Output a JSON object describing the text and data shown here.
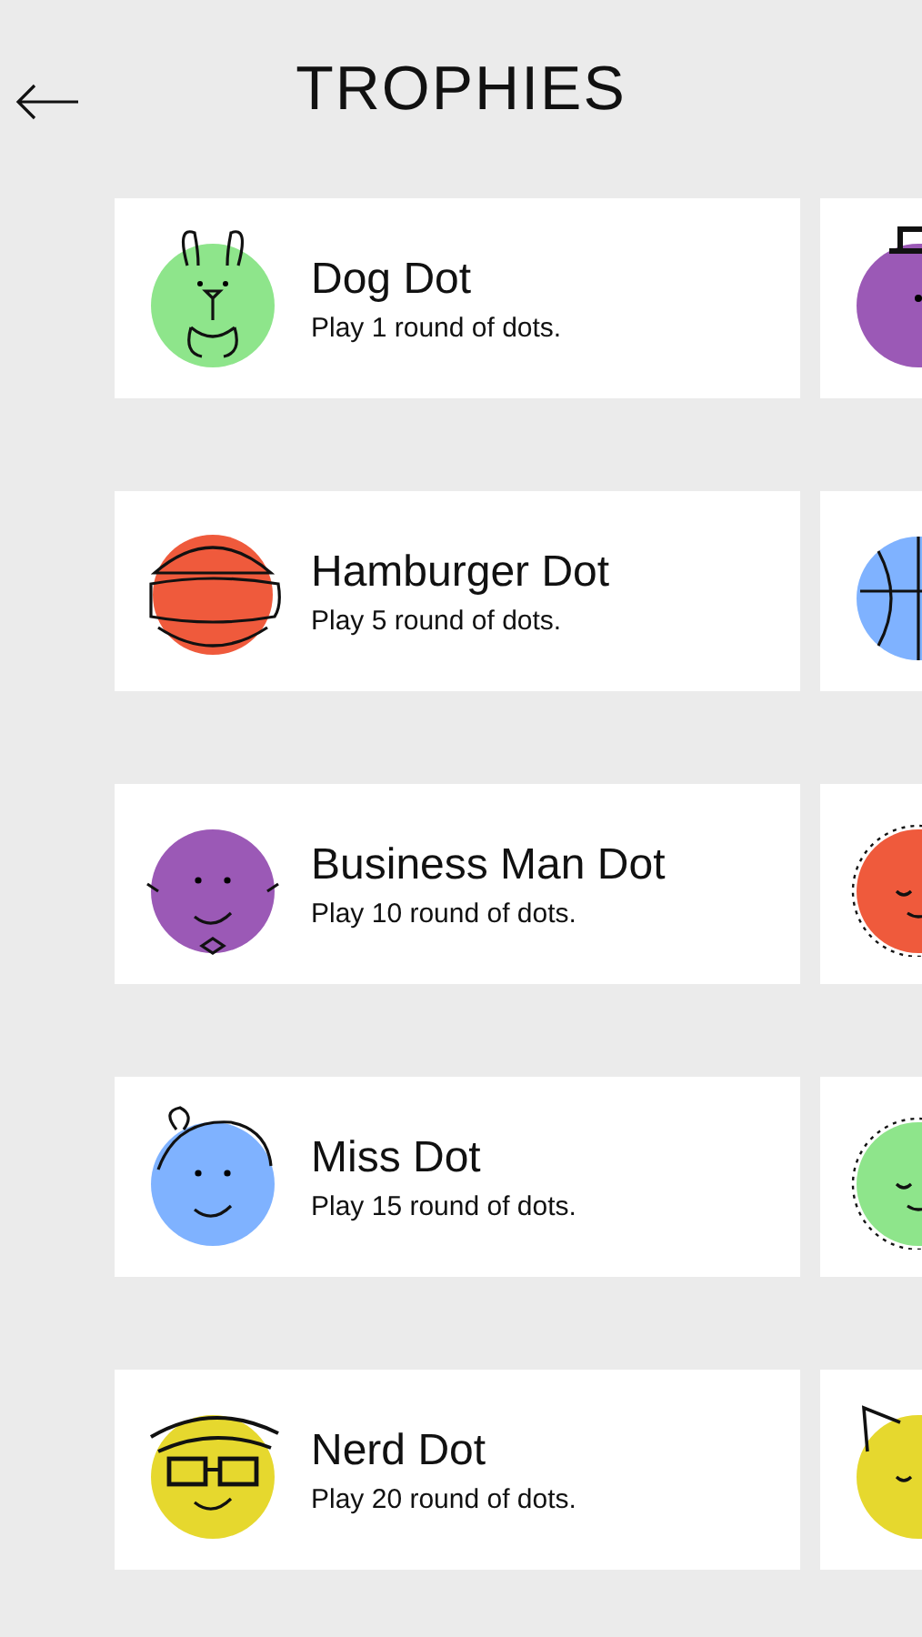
{
  "header": {
    "title": "TROPHIES"
  },
  "rows": [
    {
      "left": {
        "kind": "dog",
        "color": "#8ee58b",
        "name": "Dog Dot",
        "description": "Play 1 round of dots."
      },
      "right": {
        "kind": "tophat",
        "color": "#9b59b6"
      }
    },
    {
      "left": {
        "kind": "hamburger",
        "color": "#ef5a3c",
        "name": "Hamburger Dot",
        "description": "Play 5 round of dots."
      },
      "right": {
        "kind": "ball",
        "color": "#7fb2ff"
      }
    },
    {
      "left": {
        "kind": "businessman",
        "color": "#9b59b6",
        "name": "Business Man Dot",
        "description": "Play 10 round of dots."
      },
      "right": {
        "kind": "furry",
        "color": "#ef5a3c"
      }
    },
    {
      "left": {
        "kind": "miss",
        "color": "#7fb2ff",
        "name": "Miss Dot",
        "description": "Play 15 round of dots."
      },
      "right": {
        "kind": "fuzzy",
        "color": "#8ee58b"
      }
    },
    {
      "left": {
        "kind": "nerd",
        "color": "#e6d82e",
        "name": "Nerd Dot",
        "description": "Play 20 round of dots."
      },
      "right": {
        "kind": "cat",
        "color": "#e6d82e"
      }
    }
  ]
}
